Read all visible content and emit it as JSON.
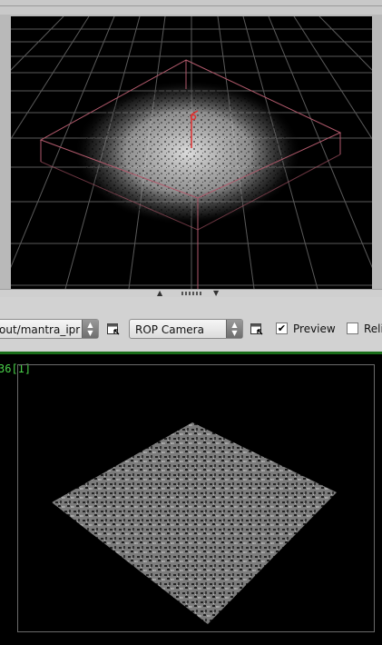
{
  "viewport": {
    "label": "3D scene viewport - cloud volume"
  },
  "toolbar": {
    "output_driver": "out/mantra_ipr",
    "camera": "ROP Camera",
    "preview_label": "Preview",
    "preview_checked": true,
    "second_checkbox_label": "Reli",
    "second_checked": false
  },
  "render": {
    "frame_label": "36[1]"
  },
  "colors": {
    "bounding_box": "#b0596b",
    "frame_label": "#49d049",
    "divider_green": "#1a6e1a"
  }
}
